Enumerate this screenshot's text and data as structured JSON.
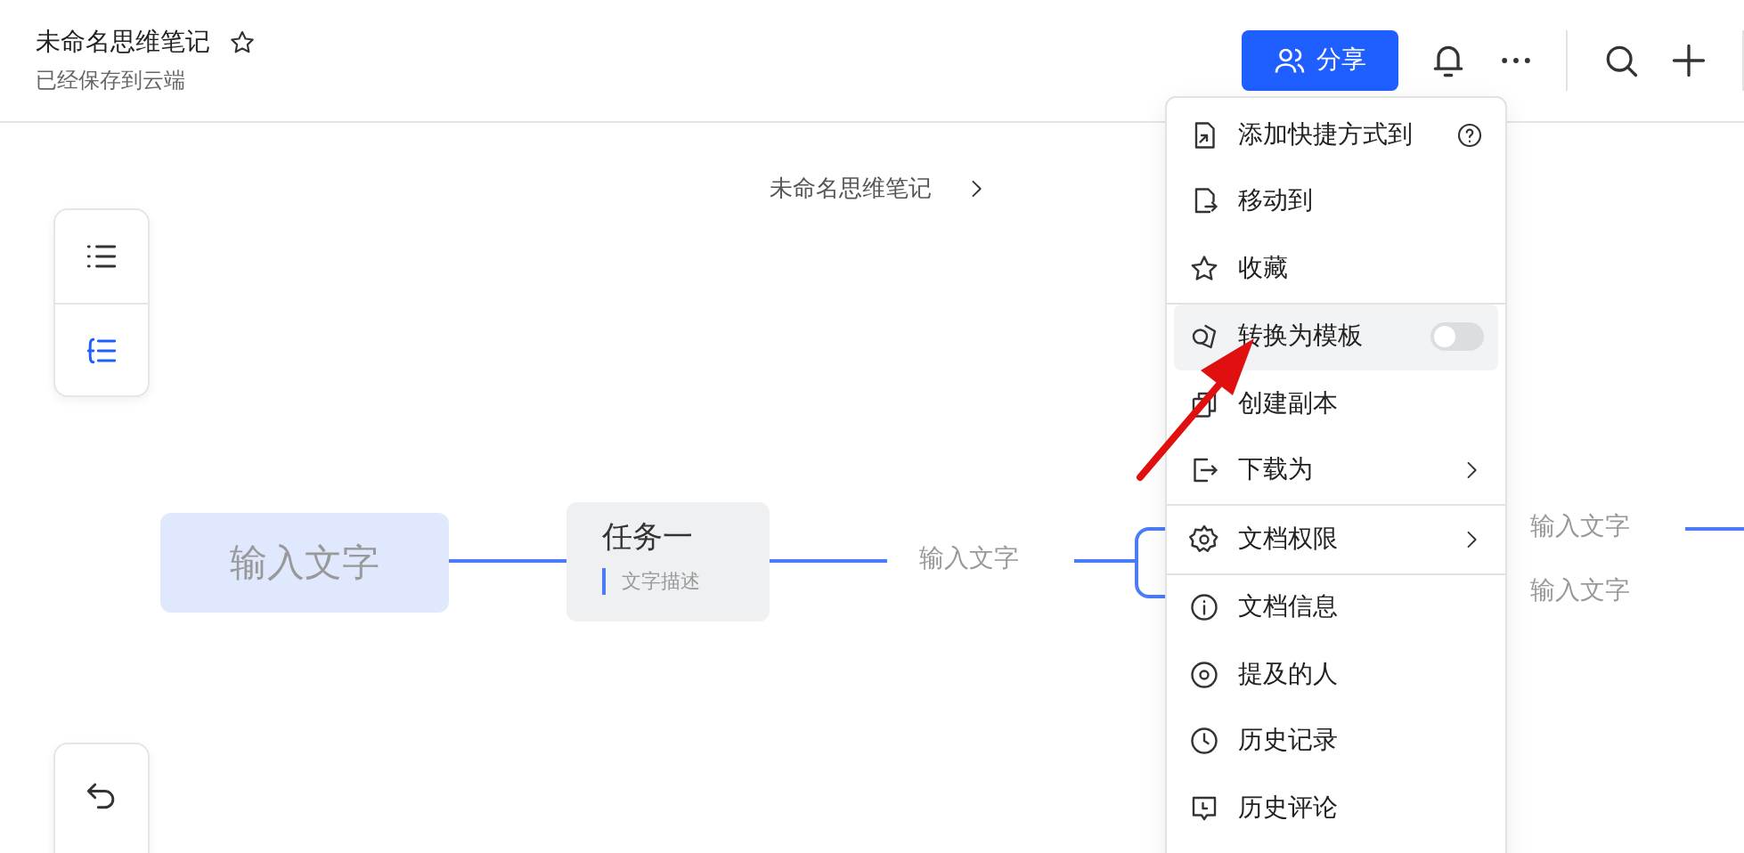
{
  "header": {
    "title": "未命名思维笔记",
    "starred": false,
    "subtitle": "已经保存到云端",
    "share_button": "分享"
  },
  "breadcrumb": {
    "label": "未命名思维笔记"
  },
  "mindmap": {
    "root": "输入文字",
    "task": {
      "title": "任务一",
      "description": "文字描述"
    },
    "branch": "输入文字",
    "right_labels": [
      "输入文字",
      "输入文字"
    ]
  },
  "menu": {
    "items": [
      {
        "kind": "help",
        "label": "添加快捷方式到"
      },
      {
        "kind": "action",
        "label": "移动到"
      },
      {
        "kind": "action",
        "label": "收藏",
        "divider_after": true
      },
      {
        "kind": "toggle",
        "label": "转换为模板",
        "on": false,
        "highlighted": true
      },
      {
        "kind": "action",
        "label": "创建副本"
      },
      {
        "kind": "submenu",
        "label": "下载为",
        "divider_after": true
      },
      {
        "kind": "submenu",
        "label": "文档权限",
        "divider_after": true
      },
      {
        "kind": "action",
        "label": "文档信息"
      },
      {
        "kind": "action",
        "label": "提及的人"
      },
      {
        "kind": "action",
        "label": "历史记录"
      },
      {
        "kind": "action",
        "label": "历史评论"
      }
    ]
  }
}
